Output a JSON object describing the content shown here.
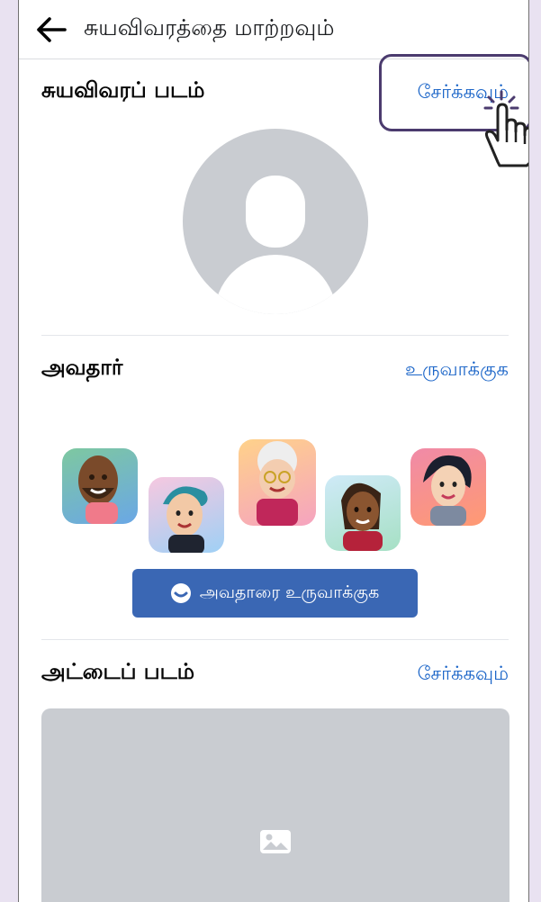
{
  "header": {
    "title": "சுயவிவரத்தை மாற்றவும்",
    "back_icon": "back-arrow-icon"
  },
  "profile_picture": {
    "title": "சுயவிவரப் படம்",
    "add_label": "சேர்க்கவும்"
  },
  "avatar": {
    "title": "அவதார்",
    "create_label": "உருவாக்குக",
    "button_label": "அவதாரை உருவாக்குக",
    "button_icon": "avatar-face-icon"
  },
  "cover_photo": {
    "title": "அட்டைப் படம்",
    "add_label": "சேர்க்கவும்",
    "placeholder_icon": "image-icon"
  },
  "colors": {
    "link": "#1b65c8",
    "button": "#3a67b4",
    "placeholder": "#c9ccd1",
    "highlight": "#4b3b6e",
    "background": "#e9e2f1"
  }
}
